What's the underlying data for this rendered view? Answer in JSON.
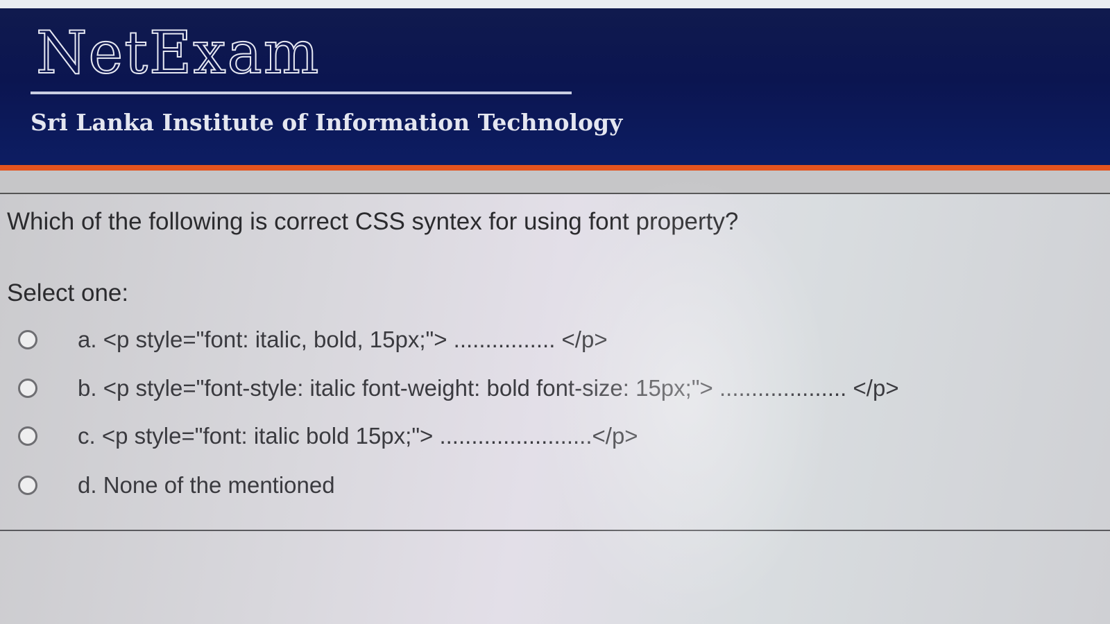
{
  "header": {
    "brand": "NetExam",
    "institute": "Sri Lanka Institute of Information Technology"
  },
  "question": {
    "text": "Which of the following is correct CSS syntex for using font property?",
    "prompt": "Select one:",
    "options": [
      {
        "label": "a. <p style=\"font: italic, bold, 15px;\"> ................ </p>",
        "selected": false
      },
      {
        "label": "b. <p style=\"font-style: italic font-weight: bold font-size: 15px;\"> .................... </p>",
        "selected": false
      },
      {
        "label": "c. <p style=\"font: italic bold 15px;\"> ........................</p>",
        "selected": false
      },
      {
        "label": "d. None of the mentioned",
        "selected": false
      }
    ]
  },
  "colors": {
    "header_bg": "#0b1550",
    "accent": "#e5541f",
    "text": "#2b2b2e"
  }
}
